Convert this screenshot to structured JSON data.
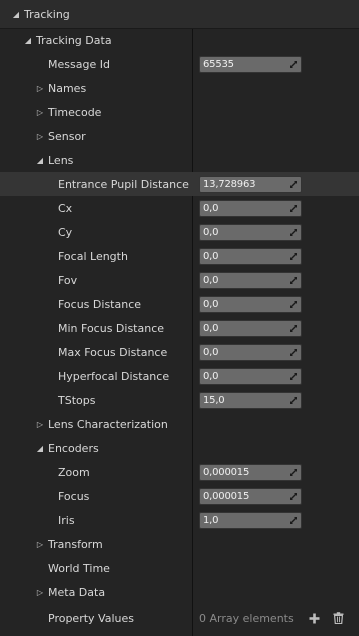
{
  "rows": [
    {
      "label": "Tracking",
      "arrow": "open",
      "indent": 0
    },
    {
      "label": "Tracking Data",
      "arrow": "open",
      "indent": 1
    },
    {
      "label": "Message Id",
      "arrow": "none",
      "indent": 2,
      "value": "65535"
    },
    {
      "label": "Names",
      "arrow": "closed",
      "indent": 2
    },
    {
      "label": "Timecode",
      "arrow": "closed",
      "indent": 2
    },
    {
      "label": "Sensor",
      "arrow": "closed",
      "indent": 2
    },
    {
      "label": "Lens",
      "arrow": "open",
      "indent": 2
    },
    {
      "label": "Entrance Pupil Distance",
      "arrow": "none",
      "indent": 3,
      "value": "13,728963",
      "highlight": true
    },
    {
      "label": "Cx",
      "arrow": "none",
      "indent": 3,
      "value": "0,0"
    },
    {
      "label": "Cy",
      "arrow": "none",
      "indent": 3,
      "value": "0,0"
    },
    {
      "label": "Focal Length",
      "arrow": "none",
      "indent": 3,
      "value": "0,0"
    },
    {
      "label": "Fov",
      "arrow": "none",
      "indent": 3,
      "value": "0,0"
    },
    {
      "label": "Focus Distance",
      "arrow": "none",
      "indent": 3,
      "value": "0,0"
    },
    {
      "label": "Min Focus Distance",
      "arrow": "none",
      "indent": 3,
      "value": "0,0"
    },
    {
      "label": "Max Focus Distance",
      "arrow": "none",
      "indent": 3,
      "value": "0,0"
    },
    {
      "label": "Hyperfocal Distance",
      "arrow": "none",
      "indent": 3,
      "value": "0,0"
    },
    {
      "label": "TStops",
      "arrow": "none",
      "indent": 3,
      "value": "15,0"
    },
    {
      "label": "Lens Characterization",
      "arrow": "closed",
      "indent": 2
    },
    {
      "label": "Encoders",
      "arrow": "open",
      "indent": 2
    },
    {
      "label": "Zoom",
      "arrow": "none",
      "indent": 3,
      "value": "0,000015"
    },
    {
      "label": "Focus",
      "arrow": "none",
      "indent": 3,
      "value": "0,000015"
    },
    {
      "label": "Iris",
      "arrow": "none",
      "indent": 3,
      "value": "1,0"
    },
    {
      "label": "Transform",
      "arrow": "closed",
      "indent": 2
    },
    {
      "label": "World Time",
      "arrow": "none",
      "indent": 2
    },
    {
      "label": "Meta Data",
      "arrow": "closed",
      "indent": 2
    },
    {
      "label": "Property Values",
      "arrow": "none",
      "indent": 2,
      "array_text": "0 Array elements"
    }
  ],
  "icons": {
    "expand": "expand-arrows-icon",
    "add": "plus-icon",
    "delete": "trash-icon"
  },
  "colors": {
    "background": "#242424",
    "section": "#2c2c2c",
    "field": "#6a6a6a",
    "highlight": "#353535",
    "text": "#d8d8d8"
  }
}
